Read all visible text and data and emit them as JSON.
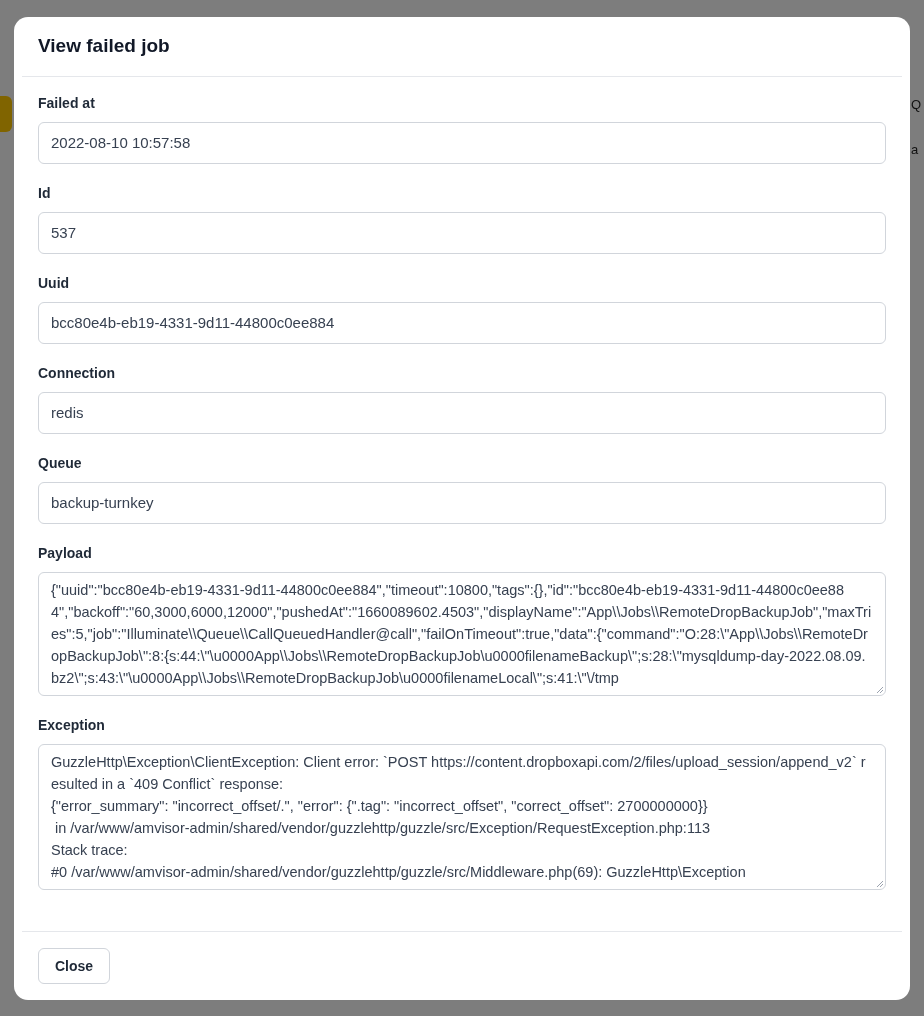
{
  "background": {
    "fragments": [
      "Q",
      "a"
    ]
  },
  "modal": {
    "title": "View failed job",
    "fields": [
      {
        "kind": "input",
        "label": "Failed at",
        "value": "2022-08-10 10:57:58"
      },
      {
        "kind": "input",
        "label": "Id",
        "value": "537"
      },
      {
        "kind": "input",
        "label": "Uuid",
        "value": "bcc80e4b-eb19-4331-9d11-44800c0ee884"
      },
      {
        "kind": "input",
        "label": "Connection",
        "value": "redis"
      },
      {
        "kind": "input",
        "label": "Queue",
        "value": "backup-turnkey"
      },
      {
        "kind": "textarea",
        "label": "Payload",
        "value": "{\"uuid\":\"bcc80e4b-eb19-4331-9d11-44800c0ee884\",\"timeout\":10800,\"tags\":{},\"id\":\"bcc80e4b-eb19-4331-9d11-44800c0ee884\",\"backoff\":\"60,3000,6000,12000\",\"pushedAt\":\"1660089602.4503\",\"displayName\":\"App\\\\Jobs\\\\RemoteDropBackupJob\",\"maxTries\":5,\"job\":\"Illuminate\\\\Queue\\\\CallQueuedHandler@call\",\"failOnTimeout\":true,\"data\":{\"command\":\"O:28:\\\"App\\\\Jobs\\\\RemoteDropBackupJob\\\":8:{s:44:\\\"\\u0000App\\\\Jobs\\\\RemoteDropBackupJob\\u0000filenameBackup\\\";s:28:\\\"mysqldump-day-2022.08.09.bz2\\\";s:43:\\\"\\u0000App\\\\Jobs\\\\RemoteDropBackupJob\\u0000filenameLocal\\\";s:41:\\\"\\/tmp"
      },
      {
        "kind": "textarea",
        "label": "Exception",
        "value": "GuzzleHttp\\Exception\\ClientException: Client error: `POST https://content.dropboxapi.com/2/files/upload_session/append_v2` resulted in a `409 Conflict` response:\n{\"error_summary\": \"incorrect_offset/.\", \"error\": {\".tag\": \"incorrect_offset\", \"correct_offset\": 2700000000}}\n in /var/www/amvisor-admin/shared/vendor/guzzlehttp/guzzle/src/Exception/RequestException.php:113\nStack trace:\n#0 /var/www/amvisor-admin/shared/vendor/guzzlehttp/guzzle/src/Middleware.php(69): GuzzleHttp\\Exception"
      }
    ],
    "close_button": "Close"
  }
}
